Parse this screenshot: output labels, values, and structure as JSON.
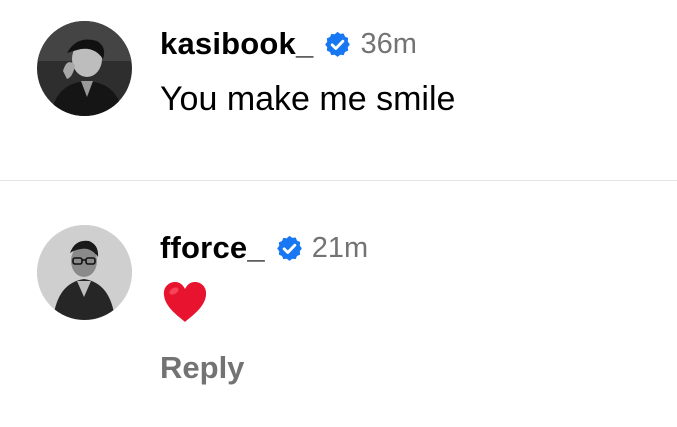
{
  "comments": [
    {
      "username": "kasibook_",
      "verified": true,
      "timestamp": "36m",
      "text": "You make me smile",
      "avatar_icon": "user-avatar-photo"
    },
    {
      "username": "fforce_",
      "verified": true,
      "timestamp": "21m",
      "emoji": "red-heart-emoji",
      "avatar_icon": "user-avatar-photo",
      "reply_label": "Reply"
    }
  ],
  "colors": {
    "verified_badge": "#1877F2",
    "secondary_text": "#737373",
    "heart": "#E8132F",
    "divider": "#E3E3E3"
  }
}
